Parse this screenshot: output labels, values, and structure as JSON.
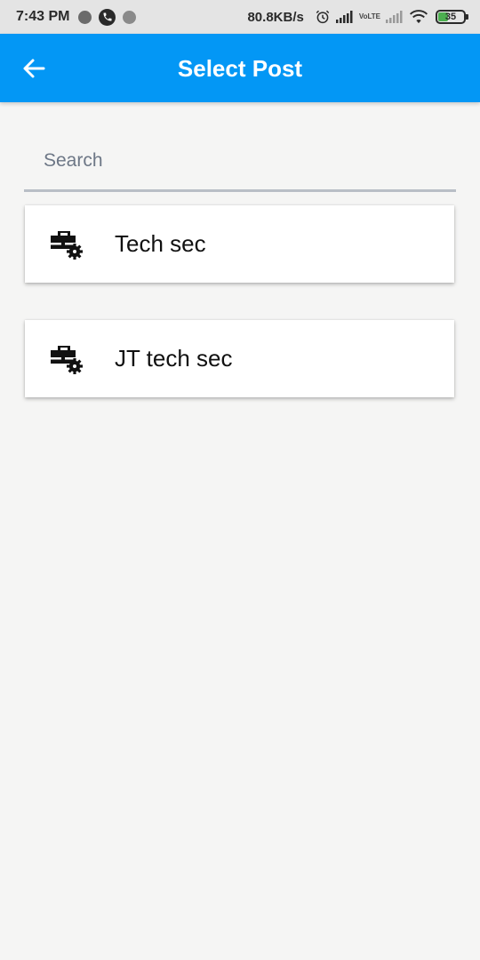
{
  "status_bar": {
    "time": "7:43 PM",
    "network_speed": "80.8KB/s",
    "volte_top": "Vo",
    "volte_bottom": "LTE",
    "battery_level": "35",
    "battery_color": "#4caf50"
  },
  "app_bar": {
    "title": "Select Post",
    "back_icon": "arrow-left-icon",
    "background": "#0397f5"
  },
  "search": {
    "placeholder": "Search",
    "value": ""
  },
  "posts": [
    {
      "label": "Tech sec",
      "icon": "briefcase-gear-icon"
    },
    {
      "label": "JT tech sec",
      "icon": "briefcase-gear-icon"
    }
  ]
}
